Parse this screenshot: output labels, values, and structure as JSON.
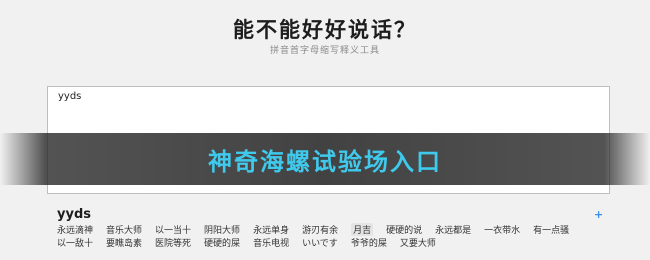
{
  "header": {
    "title": "能不能好好说话？",
    "subtitle": "拼音首字母缩写释义工具"
  },
  "input": {
    "value": "yyds"
  },
  "banner": {
    "text": "神奇海螺试验场入口"
  },
  "result": {
    "word": "yyds",
    "add_icon": "+",
    "row1": [
      "永远滴神",
      "音乐大师",
      "以一当十",
      "阴阳大师",
      "永远单身",
      "游刃有余",
      "月吉",
      "硬硬的说",
      "永远都是",
      "一衣带水",
      "有一点骚"
    ],
    "row2": [
      "以一敌十",
      "要瞧岛素",
      "医院等死",
      "硬硬的屎",
      "音乐电视",
      "いいです",
      "爷爷的屎",
      "又要大师"
    ]
  },
  "colors": {
    "banner_text": "#3fc9ec",
    "add_icon": "#3a8ee6"
  }
}
